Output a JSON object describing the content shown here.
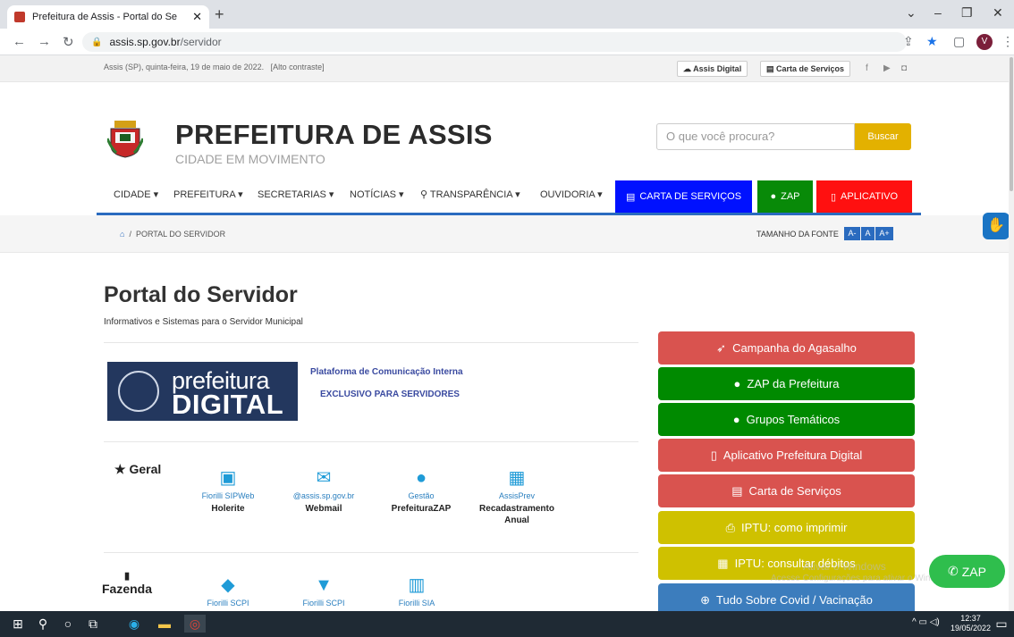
{
  "browser": {
    "tab_title": "Prefeitura de Assis - Portal do Se",
    "url_host": "assis.sp.gov.br",
    "url_path": "/servidor",
    "avatar_letter": "V"
  },
  "topbar": {
    "date": "Assis (SP), quinta-feira, 19 de maio de 2022",
    "contrast": "[Alto contraste]",
    "assis_digital": "Assis Digital",
    "carta": "Carta de Serviços"
  },
  "header": {
    "title": "PREFEITURA DE ASSIS",
    "subtitle": "CIDADE EM MOVIMENTO",
    "search_placeholder": "O que você procura?",
    "search_button": "Buscar"
  },
  "nav": {
    "items": [
      "CIDADE",
      "PREFEITURA",
      "SECRETARIAS",
      "NOTÍCIAS",
      "TRANSPARÊNCIA",
      "OUVIDORIA"
    ],
    "carta": "CARTA DE SERVIÇOS",
    "zap": "ZAP",
    "app": "APLICATIVO",
    "colors": {
      "carta": "#0011ff",
      "zap": "#088a08",
      "app": "#ff1010",
      "line": "#2a6bbf"
    }
  },
  "breadcrumb": {
    "current": "PORTAL DO SERVIDOR",
    "font_label": "TAMANHO DA FONTE",
    "font_buttons": [
      "A-",
      "A",
      "A+"
    ]
  },
  "page": {
    "title": "Portal do Servidor",
    "subtitle": "Informativos e Sistemas para o Servidor Municipal",
    "logo_line1": "prefeitura",
    "logo_line2": "DIGITAL",
    "platform": "Plataforma de Comunicação Interna",
    "exclusive": "EXCLUSIVO PARA SERVIDORES"
  },
  "geral": {
    "heading": "Geral",
    "items": [
      {
        "sub": "Fiorilli SIPWeb",
        "label": "Holerite",
        "icon": "money-icon"
      },
      {
        "sub": "@assis.sp.gov.br",
        "label": "Webmail",
        "icon": "envelope-icon"
      },
      {
        "sub": "Gestão",
        "label": "PrefeituraZAP",
        "icon": "comments-icon"
      },
      {
        "sub": "AssisPrev",
        "label": "Recadastramento Anual",
        "icon": "calendar-icon"
      }
    ]
  },
  "fazenda": {
    "heading": "Fazenda",
    "items": [
      {
        "sub": "Fiorilli SCPI",
        "icon": "tags-icon"
      },
      {
        "sub": "Fiorilli SCPI",
        "icon": "inbox-icon"
      },
      {
        "sub": "Fiorilli SIA",
        "icon": "bar-chart-icon"
      }
    ]
  },
  "sidebar_buttons": [
    {
      "label": "Campanha do Agasalho",
      "color": "#d9534f",
      "icon": "rocket-icon"
    },
    {
      "label": "ZAP da Prefeitura",
      "color": "#008a00",
      "icon": "comment-icon"
    },
    {
      "label": "Grupos Temáticos",
      "color": "#008a00",
      "icon": "comment-icon"
    },
    {
      "label": "Aplicativo Prefeitura Digital",
      "color": "#d9534f",
      "icon": "mobile-icon"
    },
    {
      "label": "Carta de Serviços",
      "color": "#d9534f",
      "icon": "card-icon"
    },
    {
      "label": "IPTU: como imprimir",
      "color": "#cfc100",
      "icon": "print-icon"
    },
    {
      "label": "IPTU: consultar débitos",
      "color": "#cfc100",
      "icon": "film-icon"
    },
    {
      "label": "Tudo Sobre Covid / Vacinação",
      "color": "#3c7dbd",
      "icon": "search-plus-icon"
    }
  ],
  "floating_zap": "ZAP",
  "watermark": {
    "line1": "Ativar o Windows",
    "line2": "Acesse Configurações para ativar o Windows."
  },
  "taskbar": {
    "time": "12:37",
    "date": "19/05/2022"
  }
}
